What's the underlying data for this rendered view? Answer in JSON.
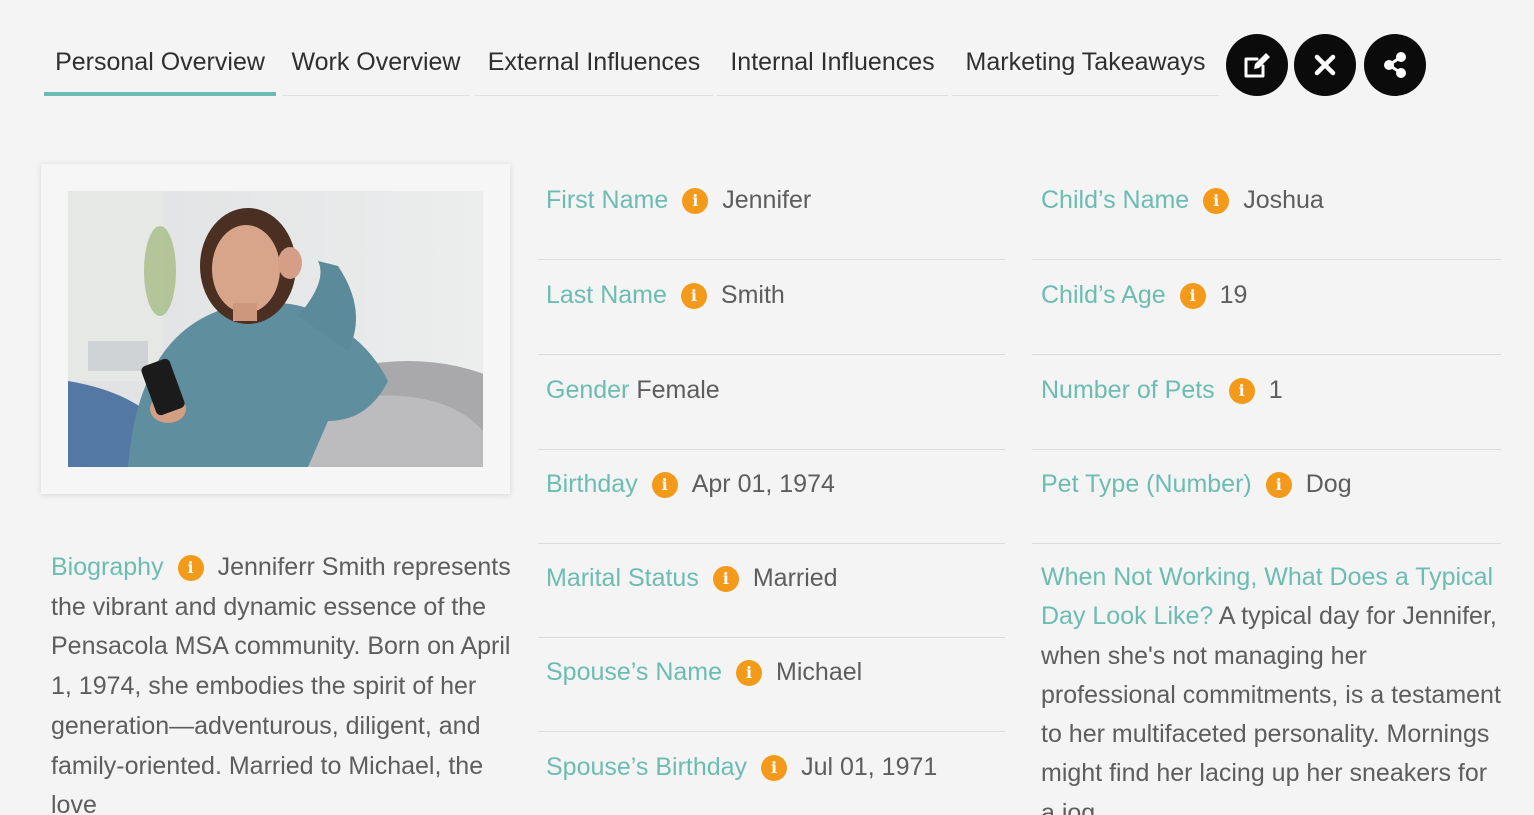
{
  "tabs": [
    {
      "label": "Personal Overview",
      "active": true
    },
    {
      "label": "Work Overview",
      "active": false
    },
    {
      "label": "External Influences",
      "active": false
    },
    {
      "label": "Internal Influences",
      "active": false
    },
    {
      "label": "Marketing Takeaways",
      "active": false
    }
  ],
  "actions": {
    "edit": "edit-icon",
    "close": "close-icon",
    "share": "share-icon"
  },
  "colors": {
    "accent": "#6cbcb2",
    "info": "#f49a1b",
    "button": "#0b0b0b"
  },
  "bio": {
    "label": "Biography",
    "text": "Jenniferr Smith represents the vibrant and dynamic essence of the Pensacola MSA community. Born on April 1, 1974, she embodies the spirit of her generation—adventurous, diligent, and family-oriented. Married to Michael, the love"
  },
  "fields_left": [
    {
      "label": "First Name",
      "value": "Jennifer",
      "info": true
    },
    {
      "label": "Last Name",
      "value": "Smith",
      "info": true
    },
    {
      "label": "Gender",
      "value": "Female",
      "info": false
    },
    {
      "label": "Birthday",
      "value": "Apr 01, 1974",
      "info": true
    },
    {
      "label": "Marital Status",
      "value": "Married",
      "info": true
    },
    {
      "label": "Spouse’s Name",
      "value": "Michael",
      "info": true
    },
    {
      "label": "Spouse’s Birthday",
      "value": "Jul 01, 1971",
      "info": true
    }
  ],
  "fields_right": [
    {
      "label": "Child’s Name",
      "value": "Joshua",
      "info": true
    },
    {
      "label": "Child’s Age",
      "value": "19",
      "info": true
    },
    {
      "label": "Number of Pets",
      "value": "1",
      "info": true
    },
    {
      "label": "Pet Type (Number)",
      "value": "Dog",
      "info": true
    }
  ],
  "typical_day": {
    "label": "When Not Working, What Does a Typical Day Look Like?",
    "text": "A typical day for Jennifer, when she's not managing her professional commitments, is a testament to her multifaceted personality. Mornings might find her lacing up her sneakers for a jog"
  }
}
